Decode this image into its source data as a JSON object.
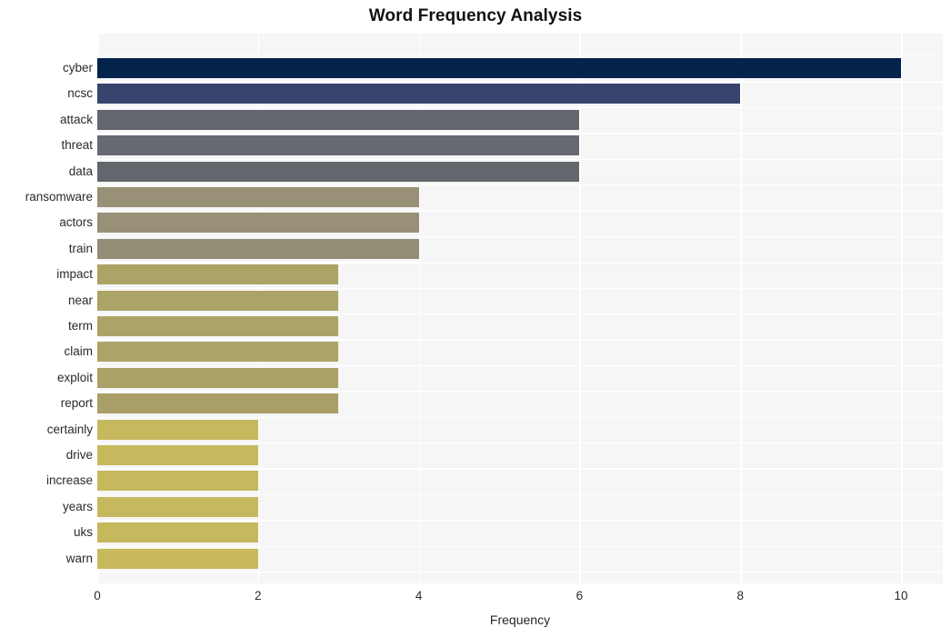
{
  "chart_data": {
    "type": "bar",
    "orientation": "horizontal",
    "title": "Word Frequency Analysis",
    "xlabel": "Frequency",
    "ylabel": "",
    "categories": [
      "cyber",
      "ncsc",
      "attack",
      "threat",
      "data",
      "ransomware",
      "actors",
      "train",
      "impact",
      "near",
      "term",
      "claim",
      "exploit",
      "report",
      "certainly",
      "drive",
      "increase",
      "years",
      "uks",
      "warn"
    ],
    "values": [
      10,
      8,
      6,
      6,
      6,
      4,
      4,
      4,
      3,
      3,
      3,
      3,
      3,
      3,
      2,
      2,
      2,
      2,
      2,
      2
    ],
    "bar_colors": [
      "#03234b",
      "#39446e",
      "#64666e",
      "#666872",
      "#64666e",
      "#989177",
      "#989177",
      "#928d74",
      "#aca367",
      "#aca367",
      "#aca367",
      "#aca367",
      "#aba066",
      "#a89e66",
      "#c6b85d",
      "#c6b85d",
      "#c6b85d",
      "#c6b85d",
      "#c6b85d",
      "#c8b95c"
    ],
    "xlim": [
      0,
      10.52
    ],
    "xticks": [
      0,
      2,
      4,
      6,
      8,
      10
    ],
    "xtick_labels": [
      "0",
      "2",
      "4",
      "6",
      "8",
      "10"
    ],
    "grid": true,
    "grid_color": "#ffffff",
    "plot_background": "#f6f6f7",
    "figure_background": "#ffffff",
    "legend": null
  }
}
